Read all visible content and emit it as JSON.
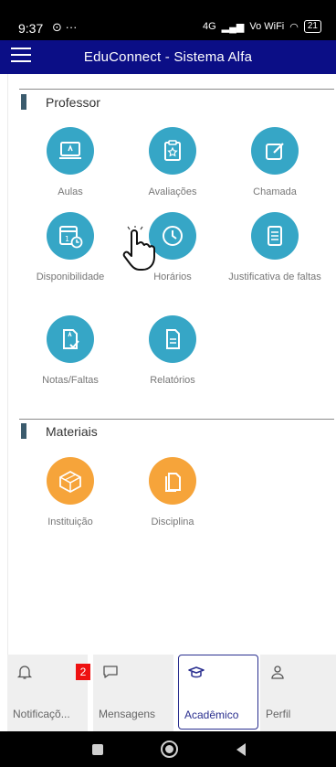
{
  "status_bar": {
    "time": "9:37",
    "notification_icons": "⊙ ···",
    "network": "4G",
    "volte": "Vo WiFi",
    "battery": "21"
  },
  "app_bar": {
    "title": "EduConnect - Sistema Alfa"
  },
  "sections": {
    "professor": {
      "label": "Professor",
      "items": [
        {
          "label": "Aulas",
          "icon": "laptop-icon"
        },
        {
          "label": "Avaliações",
          "icon": "clipboard-star-icon"
        },
        {
          "label": "Chamada",
          "icon": "edit-icon"
        },
        {
          "label": "Disponibilidade",
          "icon": "calendar-clock-icon"
        },
        {
          "label": "Horários",
          "icon": "clock-icon"
        },
        {
          "label": "Justificativa de faltas",
          "icon": "document-lines-icon"
        },
        {
          "label": "Notas/Faltas",
          "icon": "document-check-icon"
        },
        {
          "label": "Relatórios",
          "icon": "document-icon"
        }
      ]
    },
    "materiais": {
      "label": "Materiais",
      "items": [
        {
          "label": "Instituição",
          "icon": "box-icon"
        },
        {
          "label": "Disciplina",
          "icon": "files-icon"
        }
      ]
    }
  },
  "bottom_nav": {
    "items": [
      {
        "label": "Notificaçõ...",
        "icon": "bell-icon",
        "badge": "2"
      },
      {
        "label": "Mensagens",
        "icon": "message-icon"
      },
      {
        "label": "Acadêmico",
        "icon": "graduation-cap-icon"
      },
      {
        "label": "Perfil",
        "icon": "user-icon"
      }
    ],
    "active": "Acadêmico"
  },
  "colors": {
    "app_bar": "#0b0e86",
    "tile_blue": "#36a6c6",
    "tile_orange": "#f6a43a",
    "badge": "#ee1111",
    "active_nav": "#2a2f8f"
  }
}
